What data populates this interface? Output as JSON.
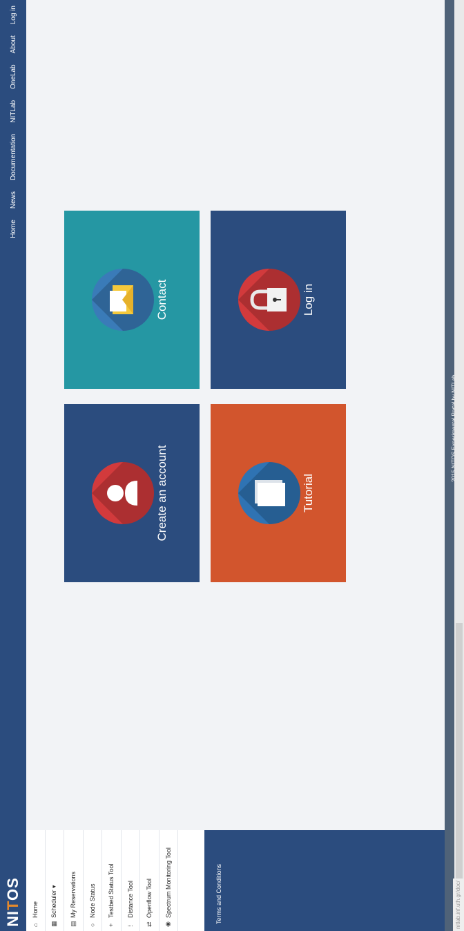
{
  "brand": {
    "logo_text_1": "NI",
    "logo_text_2": "T",
    "logo_text_3": "OS"
  },
  "nav": {
    "items": [
      "Home",
      "News",
      "Documentation",
      "NITLab",
      "OneLab",
      "About",
      "Log in"
    ]
  },
  "sidebar": {
    "items": [
      {
        "label": "Home",
        "icon": "home-icon"
      },
      {
        "label": "Scheduler ▾",
        "icon": "calendar-icon"
      },
      {
        "label": "My Reservations",
        "icon": "reservations-icon"
      },
      {
        "label": "Node Status",
        "icon": "power-icon"
      },
      {
        "label": "Testbed Status Tool",
        "icon": "plus-icon"
      },
      {
        "label": "Distance Tool",
        "icon": "distance-icon"
      },
      {
        "label": "Openflow Tool",
        "icon": "swap-icon"
      },
      {
        "label": "Spectrum Monitoring Tool",
        "icon": "globe-icon"
      }
    ],
    "terms": "Terms and Conditions"
  },
  "tiles": {
    "create_account": {
      "label": "Create an account",
      "color": "#2b4c7e",
      "circle_color": "#d23a3c",
      "icon": "user-icon"
    },
    "contact": {
      "label": "Contact",
      "color": "#2597a3",
      "circle_color": "#3a7bb8",
      "icon": "envelope-icon"
    },
    "tutorial": {
      "label": "Tutorial",
      "color": "#d2552d",
      "circle_color": "#2f73b3",
      "icon": "papers-icon"
    },
    "login": {
      "label": "Log in",
      "color": "#2b4c7e",
      "circle_color": "#d23a3c",
      "icon": "lock-icon"
    }
  },
  "footer": {
    "copyright": "2015 NITOS Experimental Portal by NITLab"
  },
  "status_url": "nitlab.inf.uth.gr/doc/"
}
